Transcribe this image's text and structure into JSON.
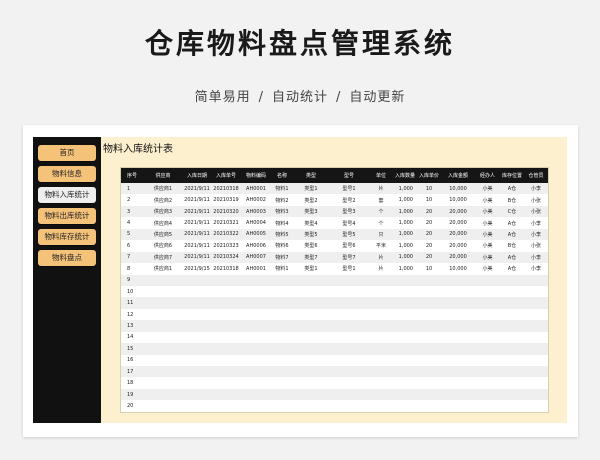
{
  "header": {
    "title": "仓库物料盘点管理系统",
    "subtitle_parts": [
      "简单易用",
      "自动统计",
      "自动更新"
    ],
    "separator": "/"
  },
  "sidebar": {
    "items": [
      {
        "label": "首页",
        "active": false
      },
      {
        "label": "物料信息",
        "active": false
      },
      {
        "label": "物料入库统计",
        "active": true
      },
      {
        "label": "物料出库统计",
        "active": false
      },
      {
        "label": "物料库存统计",
        "active": false
      },
      {
        "label": "物料盘点",
        "active": false
      }
    ]
  },
  "main": {
    "title": "物料入库统计表",
    "table": {
      "columns": [
        "序号",
        "供应商",
        "入库日期",
        "入库单号",
        "物料编码",
        "名称",
        "类型",
        "型号",
        "单位",
        "入库数量",
        "入库单价",
        "入库金额",
        "经办人",
        "库存位置",
        "仓管员"
      ],
      "rows": [
        [
          "1",
          "供应商1",
          "2021/9/11",
          "20210318",
          "AH0001",
          "物料1",
          "类型1",
          "型号1",
          "片",
          "1,000",
          "10",
          "10,000",
          "小美",
          "A仓",
          "小李"
        ],
        [
          "2",
          "供应商2",
          "2021/9/11",
          "20210319",
          "AH0002",
          "物料2",
          "类型2",
          "型号2",
          "套",
          "1,000",
          "10",
          "10,000",
          "小美",
          "B仓",
          "小张"
        ],
        [
          "3",
          "供应商3",
          "2021/9/11",
          "20210320",
          "AH0003",
          "物料3",
          "类型3",
          "型号3",
          "个",
          "1,000",
          "20",
          "20,000",
          "小美",
          "C仓",
          "小张"
        ],
        [
          "4",
          "供应商4",
          "2021/9/11",
          "20210321",
          "AH0004",
          "物料4",
          "类型4",
          "型号4",
          "个",
          "1,000",
          "20",
          "20,000",
          "小美",
          "A仓",
          "小李"
        ],
        [
          "5",
          "供应商5",
          "2021/9/11",
          "20210322",
          "AH0005",
          "物料5",
          "类型5",
          "型号5",
          "只",
          "1,000",
          "20",
          "20,000",
          "小美",
          "A仓",
          "小李"
        ],
        [
          "6",
          "供应商6",
          "2021/9/11",
          "20210323",
          "AH0006",
          "物料6",
          "类型6",
          "型号6",
          "平米",
          "1,000",
          "20",
          "20,000",
          "小美",
          "B仓",
          "小张"
        ],
        [
          "7",
          "供应商7",
          "2021/9/11",
          "20210324",
          "AH0007",
          "物料7",
          "类型7",
          "型号7",
          "片",
          "1,000",
          "20",
          "20,000",
          "小美",
          "A仓",
          "小李"
        ],
        [
          "8",
          "供应商1",
          "2021/9/15",
          "20210318",
          "AH0001",
          "物料1",
          "类型1",
          "型号1",
          "片",
          "1,000",
          "10",
          "10,000",
          "小美",
          "A仓",
          "小李"
        ],
        [
          "9",
          "",
          "",
          "",
          "",
          "",
          "",
          "",
          "",
          "",
          "",
          "",
          "",
          "",
          ""
        ],
        [
          "10",
          "",
          "",
          "",
          "",
          "",
          "",
          "",
          "",
          "",
          "",
          "",
          "",
          "",
          ""
        ],
        [
          "11",
          "",
          "",
          "",
          "",
          "",
          "",
          "",
          "",
          "",
          "",
          "",
          "",
          "",
          ""
        ],
        [
          "12",
          "",
          "",
          "",
          "",
          "",
          "",
          "",
          "",
          "",
          "",
          "",
          "",
          "",
          ""
        ],
        [
          "13",
          "",
          "",
          "",
          "",
          "",
          "",
          "",
          "",
          "",
          "",
          "",
          "",
          "",
          ""
        ],
        [
          "14",
          "",
          "",
          "",
          "",
          "",
          "",
          "",
          "",
          "",
          "",
          "",
          "",
          "",
          ""
        ],
        [
          "15",
          "",
          "",
          "",
          "",
          "",
          "",
          "",
          "",
          "",
          "",
          "",
          "",
          "",
          ""
        ],
        [
          "16",
          "",
          "",
          "",
          "",
          "",
          "",
          "",
          "",
          "",
          "",
          "",
          "",
          "",
          ""
        ],
        [
          "17",
          "",
          "",
          "",
          "",
          "",
          "",
          "",
          "",
          "",
          "",
          "",
          "",
          "",
          ""
        ],
        [
          "18",
          "",
          "",
          "",
          "",
          "",
          "",
          "",
          "",
          "",
          "",
          "",
          "",
          "",
          ""
        ],
        [
          "19",
          "",
          "",
          "",
          "",
          "",
          "",
          "",
          "",
          "",
          "",
          "",
          "",
          "",
          ""
        ],
        [
          "20",
          "",
          "",
          "",
          "",
          "",
          "",
          "",
          "",
          "",
          "",
          "",
          "",
          "",
          ""
        ]
      ]
    }
  },
  "colors": {
    "sidebar_bg": "#111111",
    "nav_button": "#f5c27a",
    "nav_active": "#efefef",
    "content_bg": "#fdf0cf",
    "header_row": "#151515"
  }
}
